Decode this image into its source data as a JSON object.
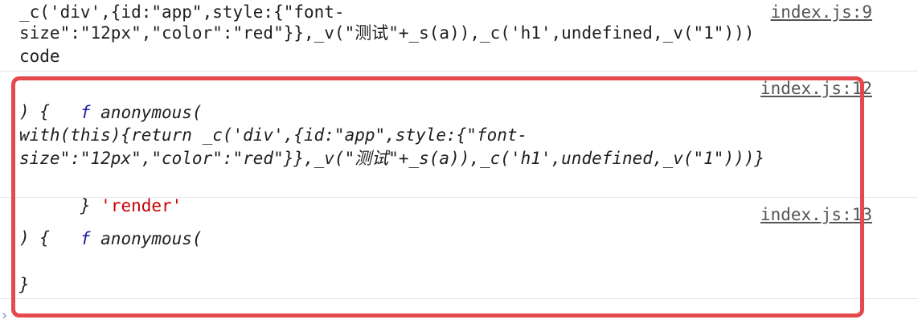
{
  "entries": [
    {
      "source": "index.js:9",
      "lines": [
        "_c('div',{id:\"app\",style:{\"font-",
        "size\":\"12px\",\"color\":\"red\"}},_v(\"测试\"+_s(a)),_c('h1',undefined,_v(\"1\")))",
        "code"
      ]
    },
    {
      "source": "index.js:12",
      "f_symbol": "f",
      "header": " anonymous(",
      "lines": [
        ") {",
        "with(this){return _c('div',{id:\"app\",style:{\"font-",
        "size\":\"12px\",\"color\":\"red\"}},_v(\"测试\"+_s(a)),_c('h1',undefined,_v(\"1\")))}",
        "}"
      ],
      "tag": "'render'"
    },
    {
      "source": "index.js:13",
      "f_symbol": "f",
      "header": " anonymous(",
      "lines": [
        ") {",
        "",
        "}"
      ]
    }
  ],
  "prompt": {
    "caret": "›"
  },
  "colors": {
    "highlight_border": "#e5484d",
    "string_red": "#c80000",
    "function_keyword": "#1a1aa6",
    "link": "#555555"
  }
}
